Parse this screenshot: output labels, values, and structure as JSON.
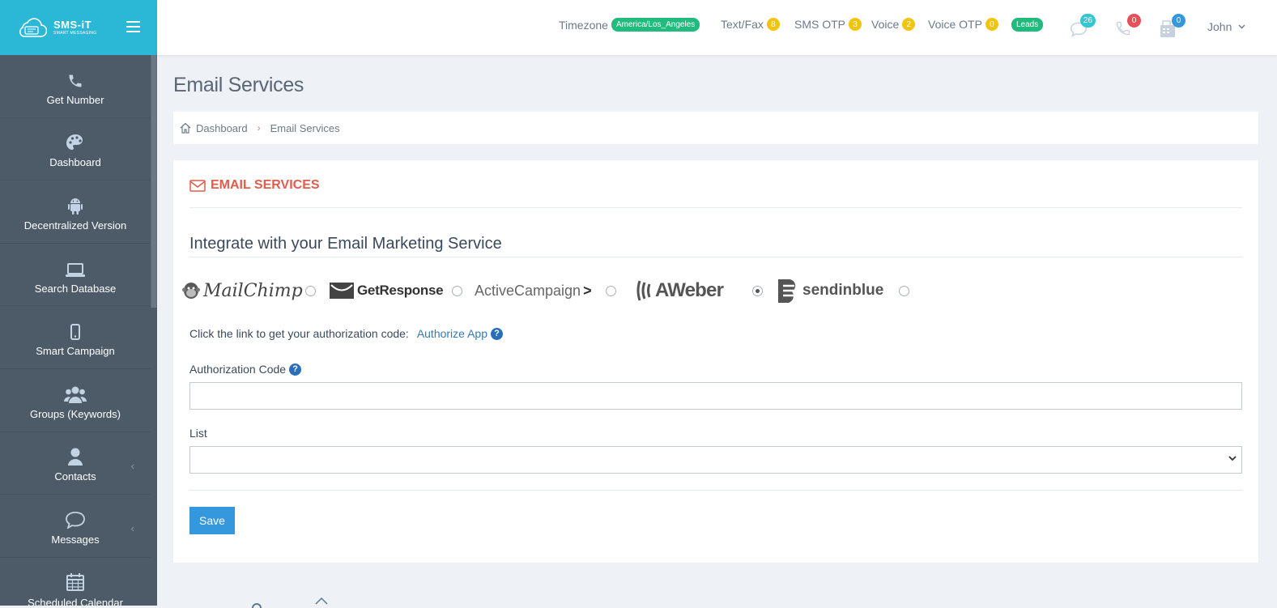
{
  "brand": {
    "name": "SMS-iT",
    "tagline": "SMART MESSAGING"
  },
  "sidebar": {
    "items": [
      {
        "label": "Get Number",
        "icon": "phone-icon"
      },
      {
        "label": "Dashboard",
        "icon": "palette-icon"
      },
      {
        "label": "Decentralized Version",
        "icon": "android-icon"
      },
      {
        "label": "Search Database",
        "icon": "laptop-icon"
      },
      {
        "label": "Smart Campaign",
        "icon": "mobile-icon"
      },
      {
        "label": "Groups (Keywords)",
        "icon": "users-icon"
      },
      {
        "label": "Contacts",
        "icon": "user-icon"
      },
      {
        "label": "Messages",
        "icon": "chat-icon"
      },
      {
        "label": "Scheduled Calendar",
        "icon": "calendar-icon"
      }
    ]
  },
  "topbar": {
    "timezone_label": "Timezone",
    "timezone_value": "America/Los_Angeles",
    "textfax_label": "Text/Fax",
    "textfax_count": "8",
    "smsotp_label": "SMS OTP",
    "smsotp_count": "3",
    "voice_label": "Voice",
    "voice_count": "2",
    "voiceotp_label": "Voice OTP",
    "voiceotp_count": "0",
    "leads_label": "Leads",
    "messages_count": "26",
    "calls_count": "0",
    "fax_count": "0",
    "user_name": "John",
    "colors": {
      "green": "#1fbc7e",
      "yellow": "#f1c40f",
      "teal": "#36c6d3",
      "red": "#e7505a",
      "blue": "#3598dc"
    }
  },
  "page": {
    "title": "Email Services",
    "breadcrumb": {
      "home": "Dashboard",
      "current": "Email Services"
    }
  },
  "panel": {
    "heading": "EMAIL SERVICES",
    "section_title": "Integrate with your Email Marketing Service",
    "providers": [
      {
        "name": "MailChimp",
        "selected": false
      },
      {
        "name": "GetResponse",
        "selected": false
      },
      {
        "name": "ActiveCampaign",
        "selected": false
      },
      {
        "name": "AWeber",
        "selected": true
      },
      {
        "name": "sendinblue",
        "selected": false
      }
    ],
    "auth_prompt": "Click the link to get your authorization code:",
    "auth_link": "Authorize App",
    "auth_code_label": "Authorization Code",
    "auth_code_value": "",
    "list_label": "List",
    "list_value": "",
    "save_label": "Save"
  }
}
